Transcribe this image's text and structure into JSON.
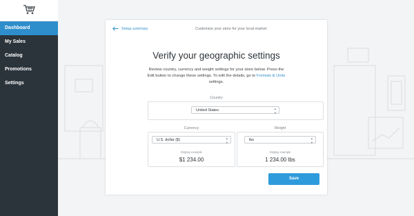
{
  "sidebar": {
    "items": [
      {
        "label": "Dashboard",
        "active": true
      },
      {
        "label": "My Sales",
        "active": false
      },
      {
        "label": "Catalog",
        "active": false
      },
      {
        "label": "Promotions",
        "active": false
      },
      {
        "label": "Settings",
        "active": false
      }
    ],
    "logo_icon": "shopping-cart-icon"
  },
  "header": {
    "back_label": "Setup summary",
    "subtitle": "Customize your store for your local market"
  },
  "main": {
    "title": "Verify your geographic settings",
    "description_part1": "Review country, currency and weight settings for your store below. Press the Edit button to change these settings. To edit the details, go to ",
    "description_link": "Formats & Units",
    "description_part2": " settings."
  },
  "country": {
    "label": "Country",
    "value": "United States"
  },
  "currency": {
    "label": "Currency",
    "value": "U.S. dollar ($)",
    "example_label": "Display example",
    "example_value": "$1 234.00"
  },
  "weight": {
    "label": "Weight",
    "value": "lbs",
    "example_label": "Display example",
    "example_value": "1 234.00 lbs"
  },
  "actions": {
    "save_label": "Save"
  },
  "colors": {
    "sidebar_bg": "#2b343b",
    "active_nav": "#2e8ecb",
    "link": "#2e8ecb",
    "primary_button": "#2e9bdc"
  }
}
